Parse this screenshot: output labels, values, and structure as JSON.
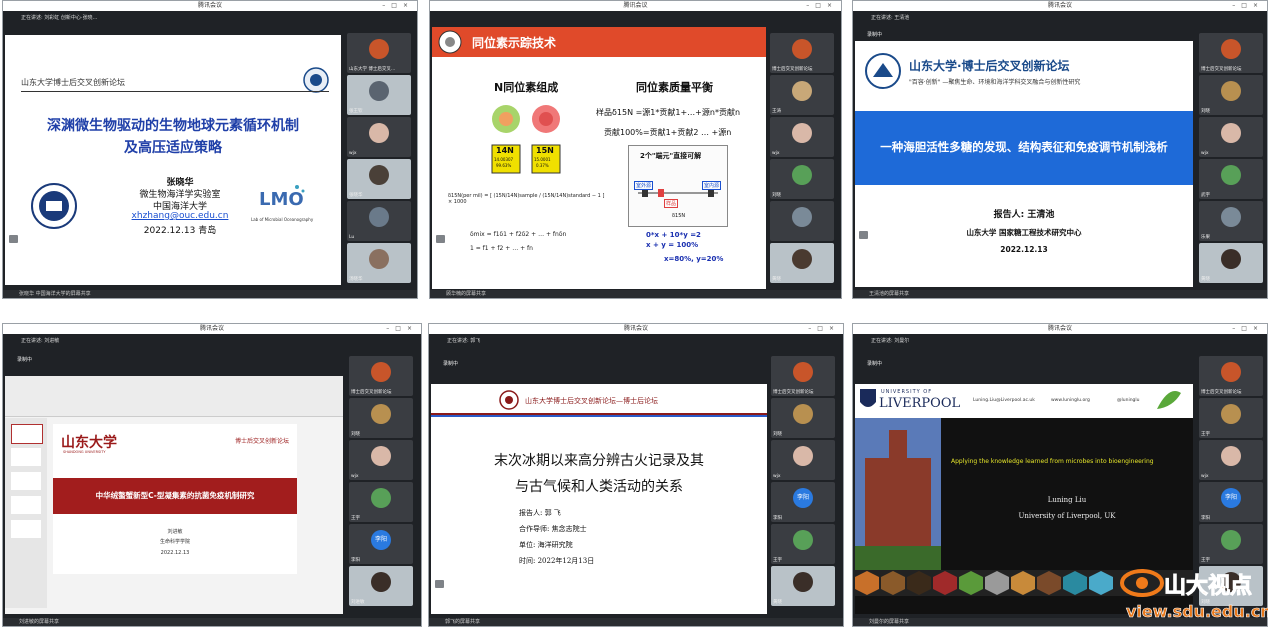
{
  "windows": {
    "w1": {
      "title": "腾讯会议",
      "share_info": "正在讲述: 刘彩虹 创新中心·张晓…",
      "bottom": "张晓华 中国海洋大学的屏幕共享",
      "slide": {
        "header": "山东大学博士后交叉创新论坛",
        "title1": "深渊微生物驱动的生物地球元素循环机制",
        "title2": "及高压适应策略",
        "speaker": "张晓华",
        "lab": "微生物海洋学实验室",
        "uni": "中国海洋大学",
        "email": "xhzhang@ouc.edu.cn",
        "date": "2022.12.13 青岛",
        "lmo_caption": "Lab of Microbial Oceanography"
      },
      "participants": [
        "山东大学 博士后交叉…",
        "张王钦",
        "wjx",
        "张晓华",
        "Lu",
        "汤晓华"
      ]
    },
    "w2": {
      "title": "腾讯会议",
      "bottom": "顾华楠的屏幕共享",
      "slide": {
        "header": "同位素示踪技术",
        "left_title": "N同位素组成",
        "right_title": "同位素质量平衡",
        "n14_label": "14N",
        "n14_mass": "14.00307",
        "n14_abund": "99.63%",
        "n15_label": "15N",
        "n15_mass": "15.0001",
        "n15_abund": "0.37%",
        "eq1": "样品δ15N =源1*贡献1+…+源n*贡献n",
        "eq2": "贡献100%=贡献1+贡献2 … +源n",
        "box_title": "2个\"端元\"直接可解",
        "end_left": "室外源",
        "end_right": "室内源",
        "sample": "样品",
        "delta_axis": "δ15N",
        "formula_delta": "δ15N(per mil) = [ (15N/14N)sample / (15N/14N)standard − 1 ] × 1000",
        "formula_mix1": "δmix = f1δ1 + f2δ2 + … + fnδn",
        "formula_mix2": "1 = f1 + f2 + … + fn",
        "b1": "0*x + 10*y =2",
        "b2": "x + y = 100%",
        "b3": "x=80%,  y=20%"
      },
      "participants": [
        "博士后交叉创新论坛",
        "王涛",
        "wjx",
        "刘晓",
        "",
        "黄晓"
      ]
    },
    "w3": {
      "title": "腾讯会议",
      "share_info": "正在讲述: 王清池",
      "rec": "录制中",
      "bottom": "王清池的屏幕共享",
      "slide": {
        "title": "山东大学·博士后交叉创新论坛",
        "subtitle": "\"百容·创新\" —聚焦生命、环境和海洋学科交叉融合与创新性研究",
        "banner": "一种海胆活性多糖的发现、结构表征和免疫调节机制浅析",
        "reporter": "报告人: 王清池",
        "org": "山东大学 国家糖工程技术研究中心",
        "date": "2022.12.13"
      },
      "participants": [
        "博士后交叉创新论坛",
        "刘晓",
        "wjx",
        "武宇",
        "乐果",
        "黄晓"
      ]
    },
    "w4": {
      "title": "腾讯会议",
      "share_info": "正在讲述: 刘进敏",
      "rec": "录制中",
      "bottom": "刘进敏的屏幕共享",
      "slide": {
        "logo": "山东大学",
        "logo_en": "SHANDONG UNIVERSITY",
        "forum": "博士后交叉创新论坛",
        "banner": "中华绒螯蟹新型C-型凝集素的抗菌免疫机制研究",
        "speaker": "刘进敏",
        "dept": "生命科学学院",
        "date": "2022.12.13"
      },
      "participants": [
        "博士后交叉创新论坛",
        "刘晓",
        "wjx",
        "王宇",
        "李阳",
        "刘进敏"
      ],
      "avatar_text": "李阳"
    },
    "w5": {
      "title": "腾讯会议",
      "share_info": "正在讲述: 郭飞",
      "rec": "录制中",
      "bottom": "郭飞的屏幕共享",
      "slide": {
        "header": "山东大学博士后交叉创新论坛—博士后论坛",
        "title1": "末次冰期以来高分辨古火记录及其",
        "title2": "与古气候和人类活动的关系",
        "reporter": "报告人: 郭 飞",
        "mentor": "合作导师: 焦念志院士",
        "unit": "单位: 海洋研究院",
        "time": "时间: 2022年12月13日"
      },
      "participants": [
        "博士后交叉创新论坛",
        "刘晓",
        "wjx",
        "李阳",
        "王宇",
        "黄晓"
      ],
      "avatar_text": "李阳"
    },
    "w6": {
      "title": "腾讯会议",
      "share_info": "正在讲述: 刘曼尔",
      "rec": "录制中",
      "bottom": "刘曼尔的屏幕共享",
      "slide": {
        "uni_small": "UNIVERSITY OF",
        "uni_big": "LIVERPOOL",
        "email": "Luning.Liu@Liverpool.ac.uk",
        "web": "www.luninglu.org",
        "twitter": "@luninglu",
        "headline": "Applying the knowledge learned from microbes into bioengineering",
        "name": "Luning Liu",
        "affil": "University of Liverpool, UK"
      },
      "participants": [
        "博士后交叉创新论坛",
        "王宇",
        "wjx",
        "李阳",
        "王宇",
        "刘晓"
      ],
      "avatar_text": "李阳"
    }
  },
  "watermark": {
    "brand": "山大视点",
    "url": "view.sdu.edu.cn"
  }
}
